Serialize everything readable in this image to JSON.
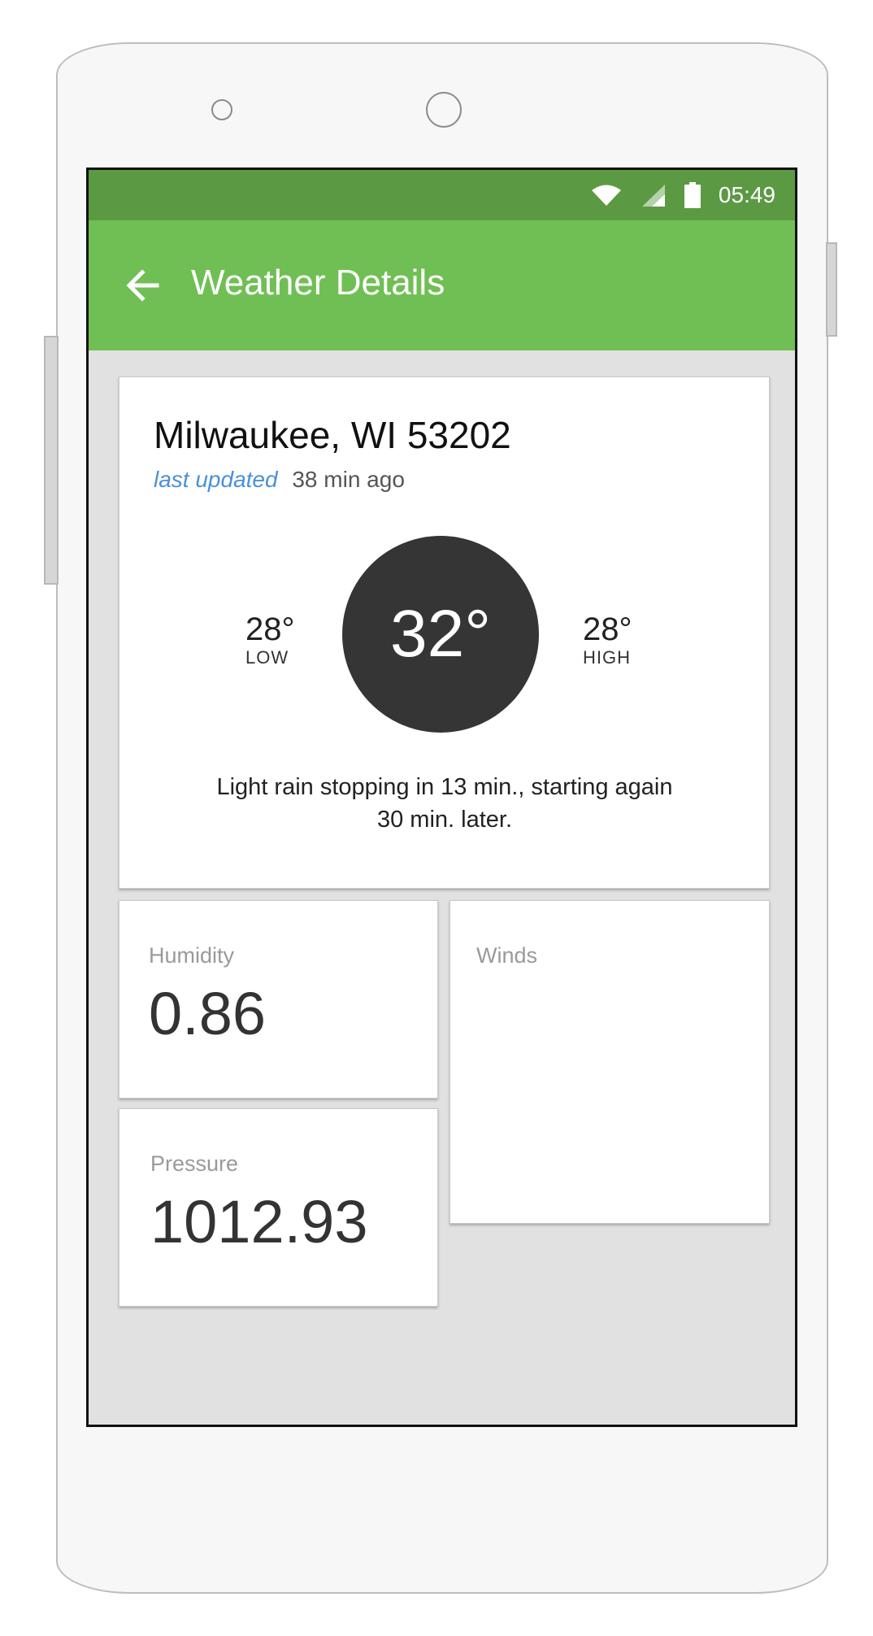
{
  "status_bar": {
    "time": "05:49",
    "icons": [
      "wifi-icon",
      "cell-signal-icon",
      "battery-icon"
    ]
  },
  "app_bar": {
    "title": "Weather Details",
    "back_icon": "arrow-left-icon",
    "color": "#70bf54",
    "status_color": "#5b9a43"
  },
  "current": {
    "location": "Milwaukee, WI 53202",
    "updated_label": "last updated",
    "updated_time": "38 min ago",
    "temperature": "32°",
    "low_value": "28°",
    "low_label": "LOW",
    "high_value": "28°",
    "high_label": "HIGH",
    "summary": "Light rain stopping in 13 min., starting again 30 min. later."
  },
  "stats": {
    "humidity_label": "Humidity",
    "humidity_value": "0.86",
    "pressure_label": "Pressure",
    "pressure_value": "1012.93",
    "winds_label": "Winds"
  }
}
